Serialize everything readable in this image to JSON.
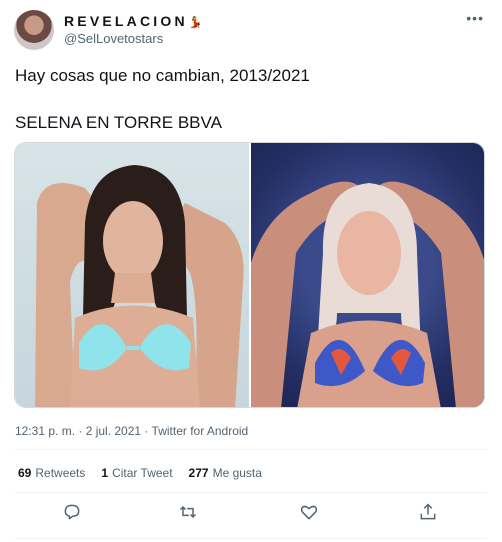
{
  "author": {
    "display_name": "REVELACION",
    "name_emoji": "💃",
    "handle": "@SelLovetostars"
  },
  "tweet": {
    "line1": "Hay cosas que no cambian, 2013/2021",
    "line2": "SELENA EN TORRE BBVA"
  },
  "meta": {
    "timestamp": "12:31 p. m. · 2 jul. 2021 · Twitter for Android"
  },
  "stats": {
    "retweets_count": "69",
    "retweets_label": "Retweets",
    "quotes_count": "1",
    "quotes_label": "Citar Tweet",
    "likes_count": "277",
    "likes_label": "Me gusta"
  },
  "icons": {
    "more": "more-icon",
    "reply": "reply-icon",
    "retweet": "retweet-icon",
    "like": "heart-icon",
    "share": "share-icon"
  },
  "colors": {
    "text_primary": "#0f1419",
    "text_secondary": "#536471",
    "divider": "#eff3f4"
  }
}
